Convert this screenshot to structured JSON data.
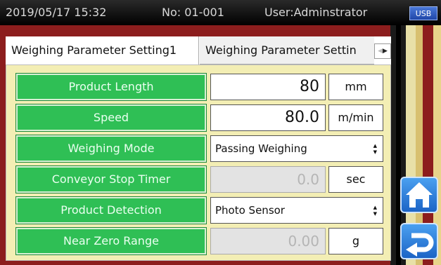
{
  "status": {
    "datetime": "2019/05/17 15:32",
    "number": "No: 01-001",
    "user": "User:Adminstrator",
    "usb": "USB"
  },
  "tabs": [
    {
      "label": "Weighing Parameter Setting1"
    },
    {
      "label": "Weighing Parameter Settin"
    }
  ],
  "rows": [
    {
      "label": "Product Length",
      "value": "80",
      "unit": "mm"
    },
    {
      "label": "Speed",
      "value": "80.0",
      "unit": "m/min"
    },
    {
      "label": "Weighing Mode",
      "value": "Passing Weighing"
    },
    {
      "label": "Conveyor Stop Timer",
      "value": "0.0",
      "unit": "sec"
    },
    {
      "label": "Product Detection",
      "value": "Photo Sensor"
    },
    {
      "label": "Near Zero Range",
      "value": "0.00",
      "unit": "g"
    }
  ],
  "icons": {
    "tab_scroll_left": "triangle-left-icon",
    "tab_scroll_right": "triangle-right-icon",
    "select_arrow": "updown-arrows-icon",
    "home": "home-icon",
    "back": "return-arrow-icon"
  },
  "colors": {
    "label_bg": "#2fbf55",
    "panel_bg": "#f3eeb4",
    "frame": "#8c1d1d",
    "button": "#1c64c6"
  }
}
